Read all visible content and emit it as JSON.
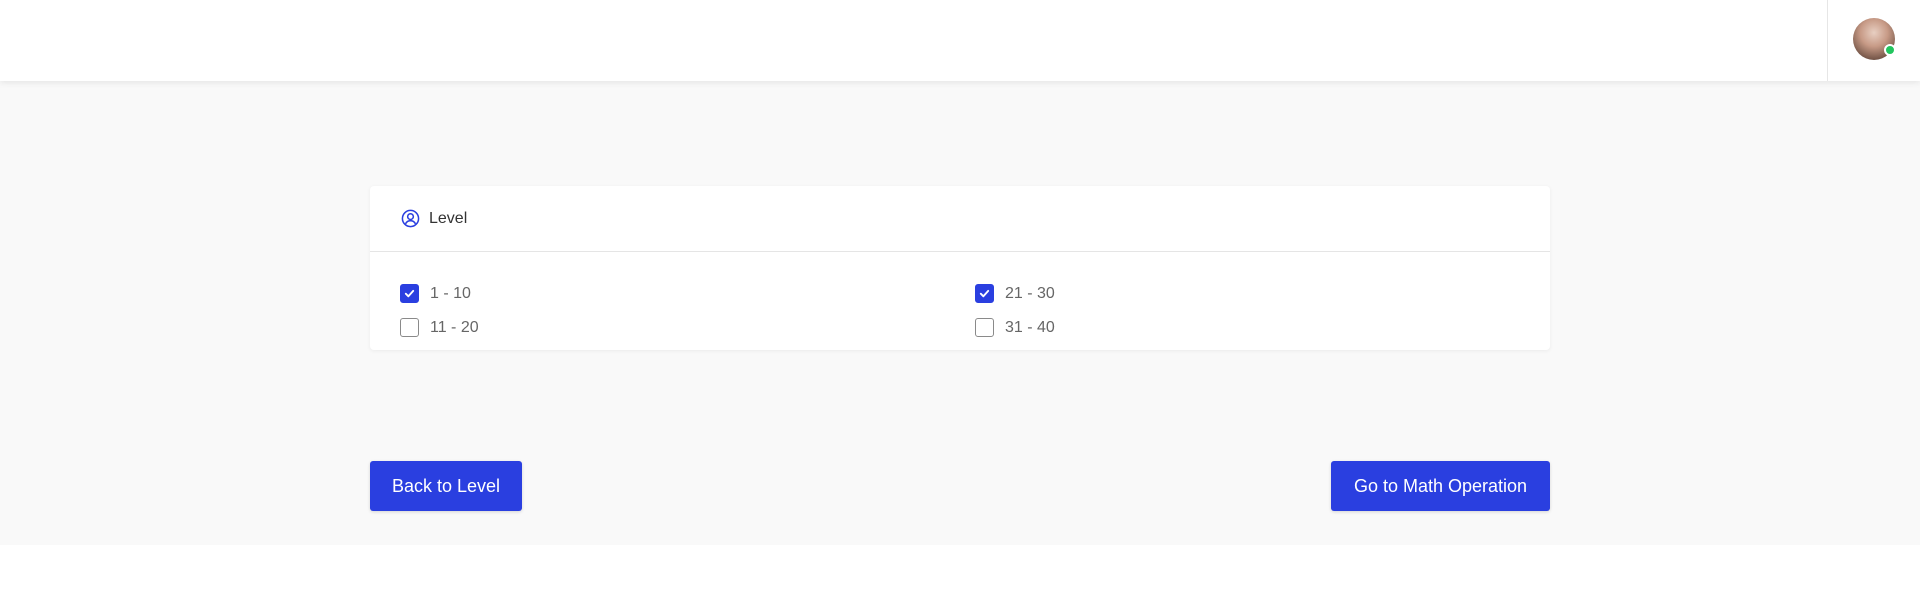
{
  "header": {
    "avatar_icon": "user-avatar",
    "status_color": "#22c55e"
  },
  "level_panel": {
    "title": "Level",
    "icon": "user-circle-icon",
    "options": [
      {
        "label": "1 - 10",
        "checked": true
      },
      {
        "label": "21 - 30",
        "checked": true
      },
      {
        "label": "11 - 20",
        "checked": false
      },
      {
        "label": "31 - 40",
        "checked": false
      }
    ]
  },
  "actions": {
    "back_label": "Back to Level",
    "next_label": "Go to Math Operation"
  },
  "colors": {
    "accent": "#2a3fe0",
    "background": "#f9f9f9"
  }
}
